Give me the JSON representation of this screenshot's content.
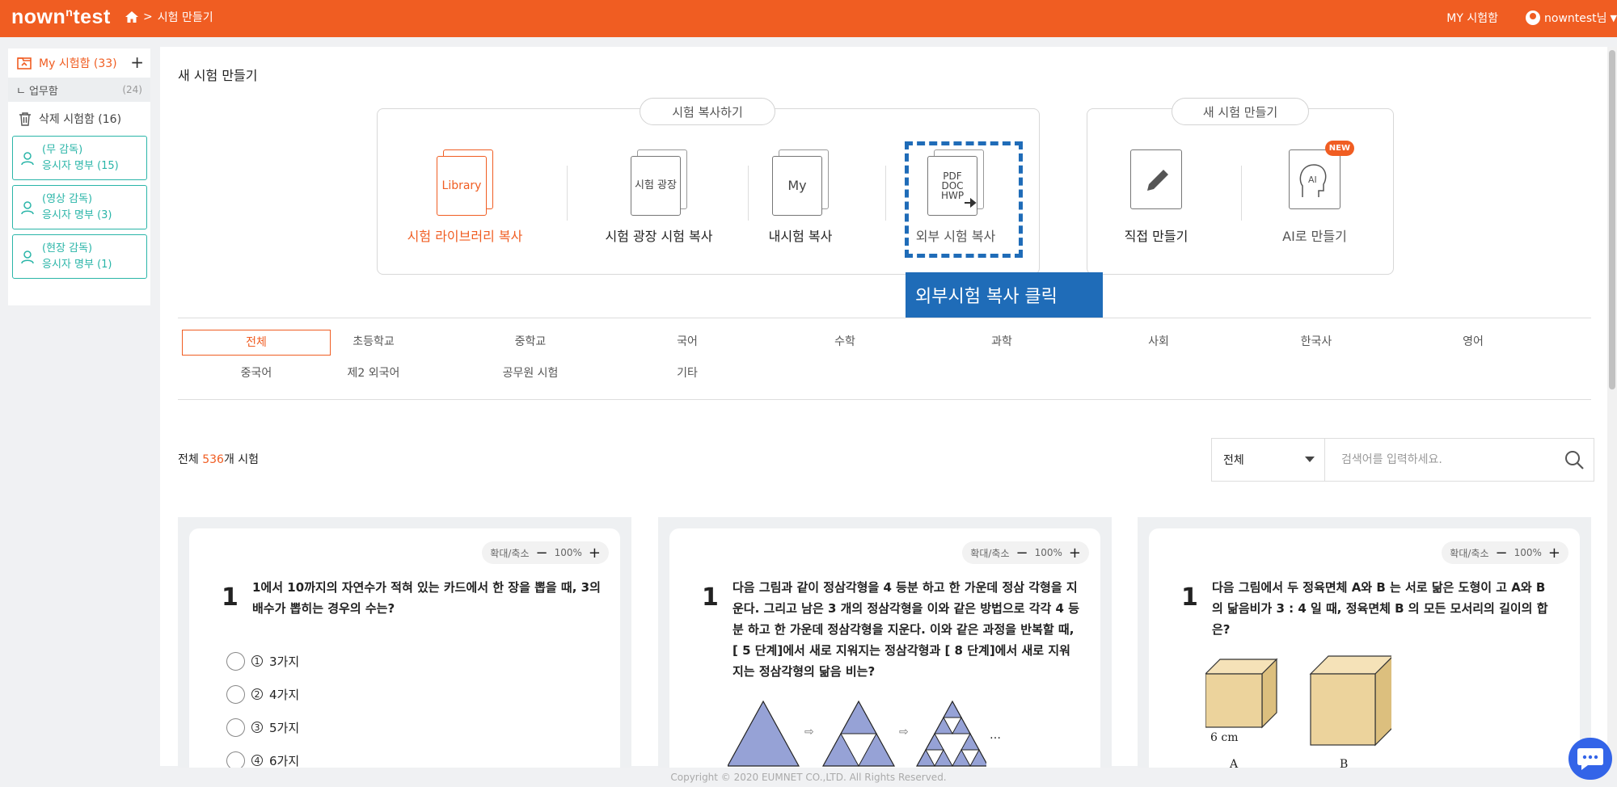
{
  "header": {
    "logo": "nowntest",
    "breadcrumb": "시험 만들기",
    "my_exams": "MY 시험함",
    "user": "nowntest님"
  },
  "sidebar": {
    "my_box": "My 시험함 (33)",
    "work_box": {
      "label": "업무함",
      "count": "(24)"
    },
    "trash": "삭제 시험함 (16)",
    "supervision": [
      {
        "line1": "(무 감독)",
        "line2": "응시자 명부 (15)"
      },
      {
        "line1": "(영상 감독)",
        "line2": "응시자 명부 (3)"
      },
      {
        "line1": "(현장 감독)",
        "line2": "응시자 명부 (1)"
      }
    ]
  },
  "page": {
    "title": "새 시험 만들기"
  },
  "copy_group": {
    "label": "시험 복사하기",
    "options": [
      {
        "icon": "Library",
        "label": "시험 라이브러리 복사"
      },
      {
        "icon": "시험 광장",
        "label": "시험 광장 시험 복사"
      },
      {
        "icon": "My",
        "label": "내시험 복사"
      },
      {
        "icon": "PDF DOC HWP",
        "label": "외부 시험 복사"
      }
    ]
  },
  "new_group": {
    "label": "새 시험 만들기",
    "options": [
      {
        "label": "직접 만들기"
      },
      {
        "label": "AI로 만들기",
        "badge": "NEW",
        "icon": "AI"
      }
    ]
  },
  "callout": "외부시험 복사 클릭",
  "categories": [
    "전체",
    "초등학교",
    "중학교",
    "국어",
    "수학",
    "과학",
    "사회",
    "한국사",
    "영어",
    "중국어",
    "제2 외국어",
    "공무원 시험",
    "기타"
  ],
  "list": {
    "prefix": "전체 ",
    "count": "536",
    "suffix": "개 시험"
  },
  "search": {
    "select": "전체",
    "placeholder": "검색어를 입력하세요."
  },
  "cards": [
    {
      "zoom_label": "확대/축소",
      "zoom": "100%",
      "num": "1",
      "text": "1에서 10까지의 자연수가 적혀 있는 카드에서 한 장을 뽑을 때, 3의 배수가 뽑히는 경우의 수는?",
      "choices": [
        {
          "n": "1",
          "t": "3가지"
        },
        {
          "n": "2",
          "t": "4가지"
        },
        {
          "n": "3",
          "t": "5가지"
        },
        {
          "n": "4",
          "t": "6가지"
        }
      ]
    },
    {
      "zoom_label": "확대/축소",
      "zoom": "100%",
      "num": "1",
      "text": "다음 그림과 같이 정삼각형을 4 등분 하고 한 가운데 정삼 각형을 지운다. 그리고 남은 3 개의 정삼각형을 이와 같은 방법으로 각각 4 등분 하고 한 가운데 정삼각형을 지운다. 이와 같은 과정을 반복할 때, [ 5 단계]에서 새로 지워지는 정삼각형과 [ 8 단계]에서 새로 지워지는 정삼각형의 닮음 비는?"
    },
    {
      "zoom_label": "확대/축소",
      "zoom": "100%",
      "num": "1",
      "text": "다음 그림에서 두 정육면체 A와 B 는 서로 닮은 도형이 고 A와 B 의 닮음비가 3 : 4 일 때, 정육면체 B 의 모든 모서리의 길이의 합은?",
      "fig": {
        "dim": "6 cm",
        "a": "A",
        "b": "B"
      }
    }
  ],
  "footer": "Copyright © 2020 EUMNET CO.,LTD. All Rights Reserved.",
  "colors": {
    "brand": "#f05d22",
    "highlight": "#1f6cb8",
    "teal": "#2ab5a8"
  }
}
